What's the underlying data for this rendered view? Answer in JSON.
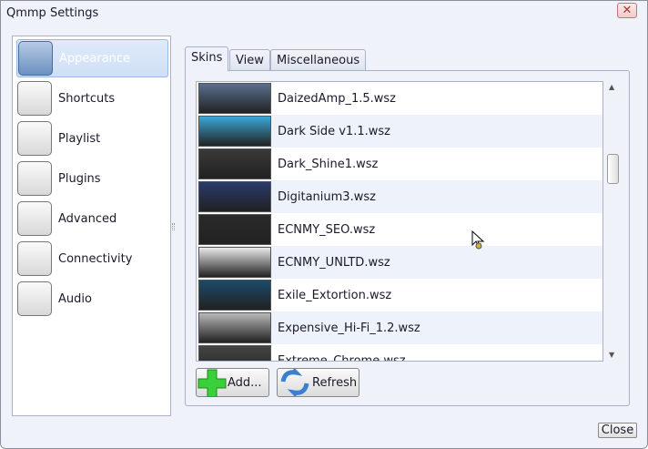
{
  "window": {
    "title": "Qmmp Settings",
    "close_label": "Close"
  },
  "sidebar": {
    "items": [
      {
        "label": "Appearance",
        "icon": "appearance-icon",
        "selected": true
      },
      {
        "label": "Shortcuts",
        "icon": "shortcuts-icon"
      },
      {
        "label": "Playlist",
        "icon": "playlist-icon"
      },
      {
        "label": "Plugins",
        "icon": "plugins-icon"
      },
      {
        "label": "Advanced",
        "icon": "advanced-icon"
      },
      {
        "label": "Connectivity",
        "icon": "connectivity-icon"
      },
      {
        "label": "Audio",
        "icon": "audio-icon"
      }
    ]
  },
  "tabs": [
    {
      "label": "Skins",
      "active": true
    },
    {
      "label": "View"
    },
    {
      "label": "Miscellaneous"
    }
  ],
  "skins": [
    {
      "name": "DaizedAmp_1.5.wsz",
      "color": "#5a6f8e"
    },
    {
      "name": "Dark Side v1.1.wsz",
      "color": "#3aa8d8"
    },
    {
      "name": "Dark_Shine1.wsz",
      "color": "#3a3a3a"
    },
    {
      "name": "Digitanium3.wsz",
      "color": "#2a3a6a"
    },
    {
      "name": "ECNMY_SEO.wsz",
      "color": "#2a2a2a"
    },
    {
      "name": "ECNMY_UNLTD.wsz",
      "color": "#e8e8e8"
    },
    {
      "name": "Exile_Extortion.wsz",
      "color": "#1a4a6a"
    },
    {
      "name": "Expensive_Hi-Fi_1.2.wsz",
      "color": "#b8b8b8"
    },
    {
      "name": "Extreme_Chrome.wsz",
      "color": "#444444"
    }
  ],
  "buttons": {
    "add": "Add...",
    "refresh": "Refresh"
  }
}
